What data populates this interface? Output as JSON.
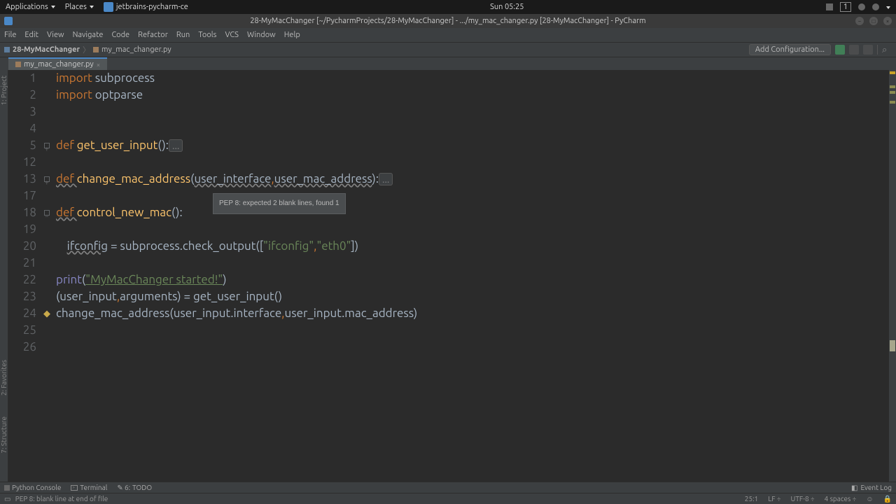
{
  "gnome": {
    "applications": "Applications",
    "places": "Places",
    "app_launcher": "jetbrains-pycharm-ce",
    "clock": "Sun 05:25",
    "workspace": "1"
  },
  "window_title": "28-MyMacChanger [~/PycharmProjects/28-MyMacChanger] - .../my_mac_changer.py [28-MyMacChanger] - PyCharm",
  "menus": [
    "File",
    "Edit",
    "View",
    "Navigate",
    "Code",
    "Refactor",
    "Run",
    "Tools",
    "VCS",
    "Window",
    "Help"
  ],
  "breadcrumbs": {
    "project": "28-MyMacChanger",
    "file": "my_mac_changer.py"
  },
  "add_config": "Add Configuration...",
  "editor_tab": "my_mac_changer.py",
  "tooltip_text": "PEP 8: expected 2 blank lines, found 1",
  "line_numbers": [
    "1",
    "2",
    "3",
    "4",
    "5",
    "12",
    "13",
    "17",
    "18",
    "19",
    "20",
    "21",
    "22",
    "23",
    "24",
    "25",
    "26"
  ],
  "code": {
    "l1_kw": "import",
    "l1_mod": " subprocess",
    "l2_kw": "import",
    "l2_mod": " optparse",
    "l5_def": "def ",
    "l5_fn": "get_user_input",
    "l5_tail": "():",
    "l5_fold": "...",
    "l13_def": "def ",
    "l13_fn": "change_mac_address",
    "l13_open": "(",
    "l13_p1": "user_interface",
    "l13_c": ",",
    "l13_p2": "user_mac_address",
    "l13_close": "):",
    "l13_fold": "...",
    "l18_def": "def ",
    "l18_fn": "control_new_mac",
    "l18_tail": "():",
    "l20_pre": "    ",
    "l20_var": "ifconfig",
    "l20_eq": " = subprocess.check_output([",
    "l20_s1": "\"ifconfig\"",
    "l20_cm": ",",
    "l20_s2": "\"eth0\"",
    "l20_end": "])",
    "l22_pr": "print",
    "l22_open": "(",
    "l22_str": "\"MyMacChanger started!\"",
    "l22_close": ")",
    "l23": "(user_input,arguments) = get_user_input()",
    "l23_a": "(user_input",
    "l23_c": ",",
    "l23_b": "arguments) = get_user_input()",
    "l24_fn": "change_mac_address",
    "l24_a": "(user_input.interface",
    "l24_c": ",",
    "l24_b": "user_input.mac_address)"
  },
  "bottom_tools": {
    "python_console": "Python Console",
    "terminal": "Terminal",
    "todo": "TODO",
    "event_log": "Event Log"
  },
  "status": {
    "msg": "PEP 8: blank line at end of file",
    "pos": "25:1",
    "line_sep": "LF",
    "encoding": "UTF-8",
    "indent": "4 spaces"
  },
  "side_tools": {
    "project": "1: Project",
    "favorites": "2: Favorites",
    "structure": "7: Structure"
  }
}
